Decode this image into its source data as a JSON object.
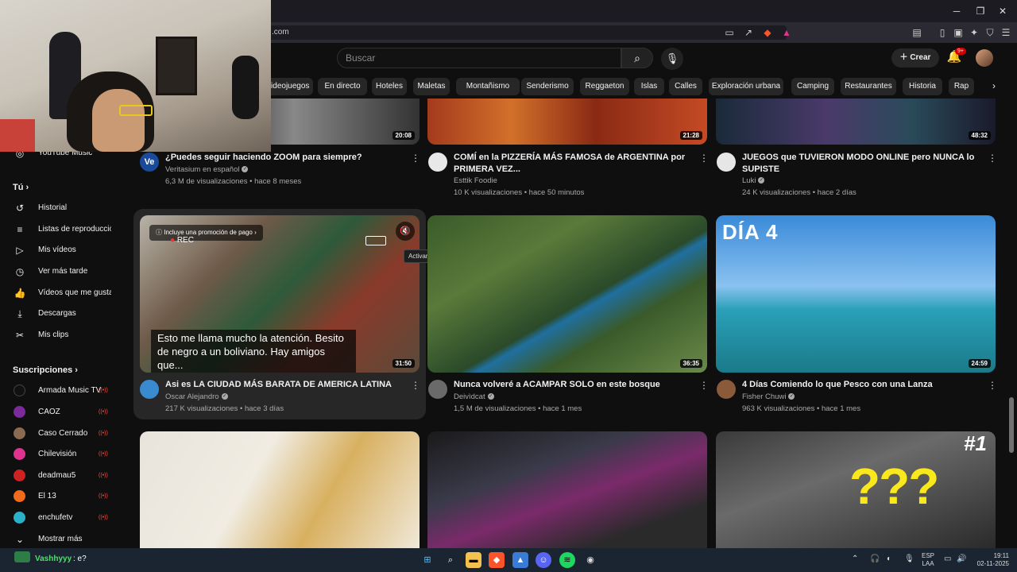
{
  "browser": {
    "url": ".com"
  },
  "youtube": {
    "search_placeholder": "Buscar",
    "create_label": "Crear",
    "notifications_badge": "9+",
    "chips": [
      "Videojuegos",
      "En directo",
      "Hoteles",
      "Maletas",
      "Montañismo",
      "Senderismo",
      "Reggaeton",
      "Islas",
      "Calles",
      "Exploración urbana",
      "Camping",
      "Restaurantes",
      "Historia",
      "Rap"
    ]
  },
  "sidebar": {
    "music_label": "YouTube Music",
    "you_heading": "Tú",
    "you_items": [
      {
        "label": "Historial",
        "icon": "history-icon"
      },
      {
        "label": "Listas de reproducción",
        "icon": "playlists-icon"
      },
      {
        "label": "Mis vídeos",
        "icon": "my-videos-icon"
      },
      {
        "label": "Ver más tarde",
        "icon": "watch-later-icon"
      },
      {
        "label": "Vídeos que me gustan",
        "icon": "liked-icon"
      },
      {
        "label": "Descargas",
        "icon": "download-icon"
      },
      {
        "label": "Mis clips",
        "icon": "clips-icon"
      }
    ],
    "subs_heading": "Suscripciones",
    "subscriptions": [
      {
        "label": "Armada Music TV",
        "color": "#111111"
      },
      {
        "label": "CAOZ",
        "color": "#7a2a9a"
      },
      {
        "label": "Caso Cerrado",
        "color": "#8a6a50"
      },
      {
        "label": "Chilevisión",
        "color": "#e0338f"
      },
      {
        "label": "deadmau5",
        "color": "#cc2222"
      },
      {
        "label": "El 13",
        "color": "#f26b1d"
      },
      {
        "label": "enchufetv",
        "color": "#2ab0c8"
      }
    ],
    "show_more": "Mostrar más"
  },
  "videos": [
    {
      "title": "¿Puedes seguir haciendo ZOOM para siempre?",
      "channel": "Veritasium en español",
      "meta": "6,3 M de visualizaciones • hace 8 meses",
      "duration": "20:08"
    },
    {
      "title": "COMÍ en la PIZZERÍA MÁS FAMOSA de ARGENTINA por PRIMERA VEZ...",
      "channel": "Esttik Foodie",
      "meta": "10 K visualizaciones • hace 50 minutos",
      "duration": "21:28"
    },
    {
      "title": "JUEGOS que TUVIERON MODO ONLINE pero NUNCA lo SUPISTE",
      "channel": "Luki",
      "meta": "24 K visualizaciones • hace 2 días",
      "duration": "48:32"
    },
    {
      "title": "Asi es LA CIUDAD MÁS BARATA DE AMERICA LATINA",
      "channel": "Oscar Alejandro",
      "meta": "217 K visualizaciones • hace 3 días",
      "duration": "31:50"
    },
    {
      "title": "Nunca volveré a ACAMPAR SOLO en este bosque",
      "channel": "Deivìdcat",
      "meta": "1,5 M de visualizaciones • hace 1 mes",
      "duration": "36:35"
    },
    {
      "title": "4 Días Comiendo lo que Pesco con una Lanza",
      "channel": "Fisher Chuwi",
      "meta": "963 K visualizaciones • hace 1 mes",
      "duration": "24:59"
    }
  ],
  "preview": {
    "promo": "Incluye una promoción de pago",
    "rec": "REC",
    "unmute_tooltip": "Activar sonido",
    "caption": "Esto me llama mucho la atención. Besito de negro a un boliviano. Hay amigos que..."
  },
  "thumb_text": {
    "dia4": "DÍA 4",
    "number1": "#1",
    "question": "???"
  },
  "taskbar": {
    "chat_user": "Vashhyyy",
    "chat_msg": ": e?",
    "lang_top": "ESP",
    "lang_bottom": "LAA",
    "time": "19:11",
    "date": "02-11-2025"
  }
}
